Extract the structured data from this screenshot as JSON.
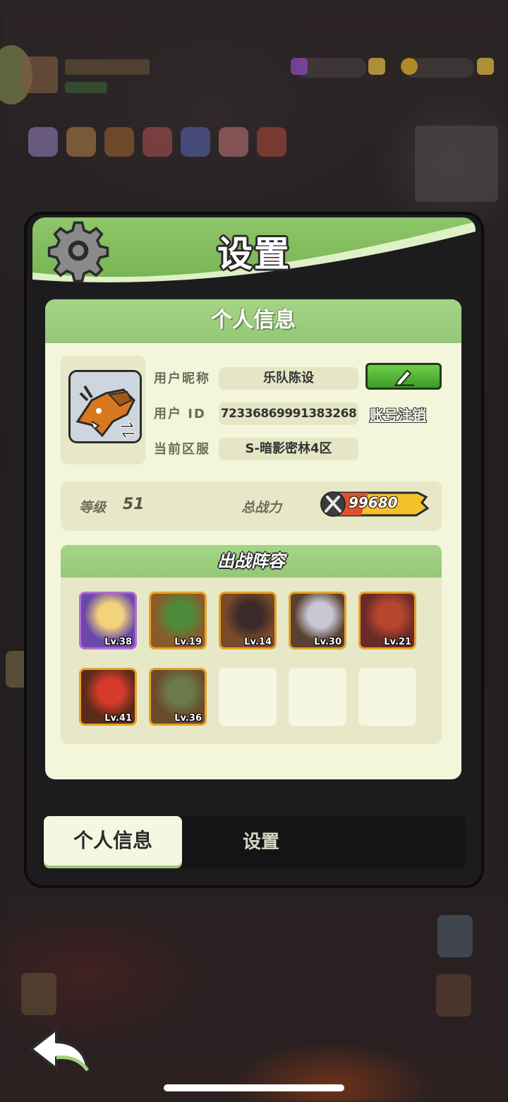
{
  "dialog": {
    "title": "设置"
  },
  "profile_panel": {
    "header": "个人信息",
    "nickname_label": "用户昵称",
    "nickname_value": "乐队陈设",
    "user_id_label": "用户 ID",
    "user_id_value": "72336869991383268",
    "server_label": "当前区服",
    "server_value": "S-暗影密林4区",
    "cancel_account_label": "账号注销",
    "level_label": "等级",
    "level_value": "51",
    "power_label": "总战力",
    "power_value": "99680"
  },
  "lineup": {
    "header": "出战阵容",
    "heroes": [
      {
        "level": "Lv.38",
        "rarity": "purple",
        "icon": "blonde-fairy-hero"
      },
      {
        "level": "Lv.19",
        "rarity": "orange",
        "icon": "green-lizard-hero"
      },
      {
        "level": "Lv.14",
        "rarity": "orange",
        "icon": "swordsman-hero"
      },
      {
        "level": "Lv.30",
        "rarity": "orange",
        "icon": "pale-mage-hero"
      },
      {
        "level": "Lv.21",
        "rarity": "orange",
        "icon": "horned-demon-hero"
      },
      {
        "level": "Lv.41",
        "rarity": "orange",
        "icon": "red-hair-warrior-hero"
      },
      {
        "level": "Lv.36",
        "rarity": "orange",
        "icon": "crocodile-hero"
      }
    ],
    "empty_slots": 3
  },
  "tabs": [
    {
      "label": "个人信息",
      "active": true
    },
    {
      "label": "设置",
      "active": false
    }
  ],
  "colors": {
    "header_green": "#8ec66a",
    "panel_cream": "#f4f6dc",
    "rare_orange": "#e7a326",
    "epic_purple": "#b76ad8",
    "edit_green": "#3d9c2a"
  }
}
